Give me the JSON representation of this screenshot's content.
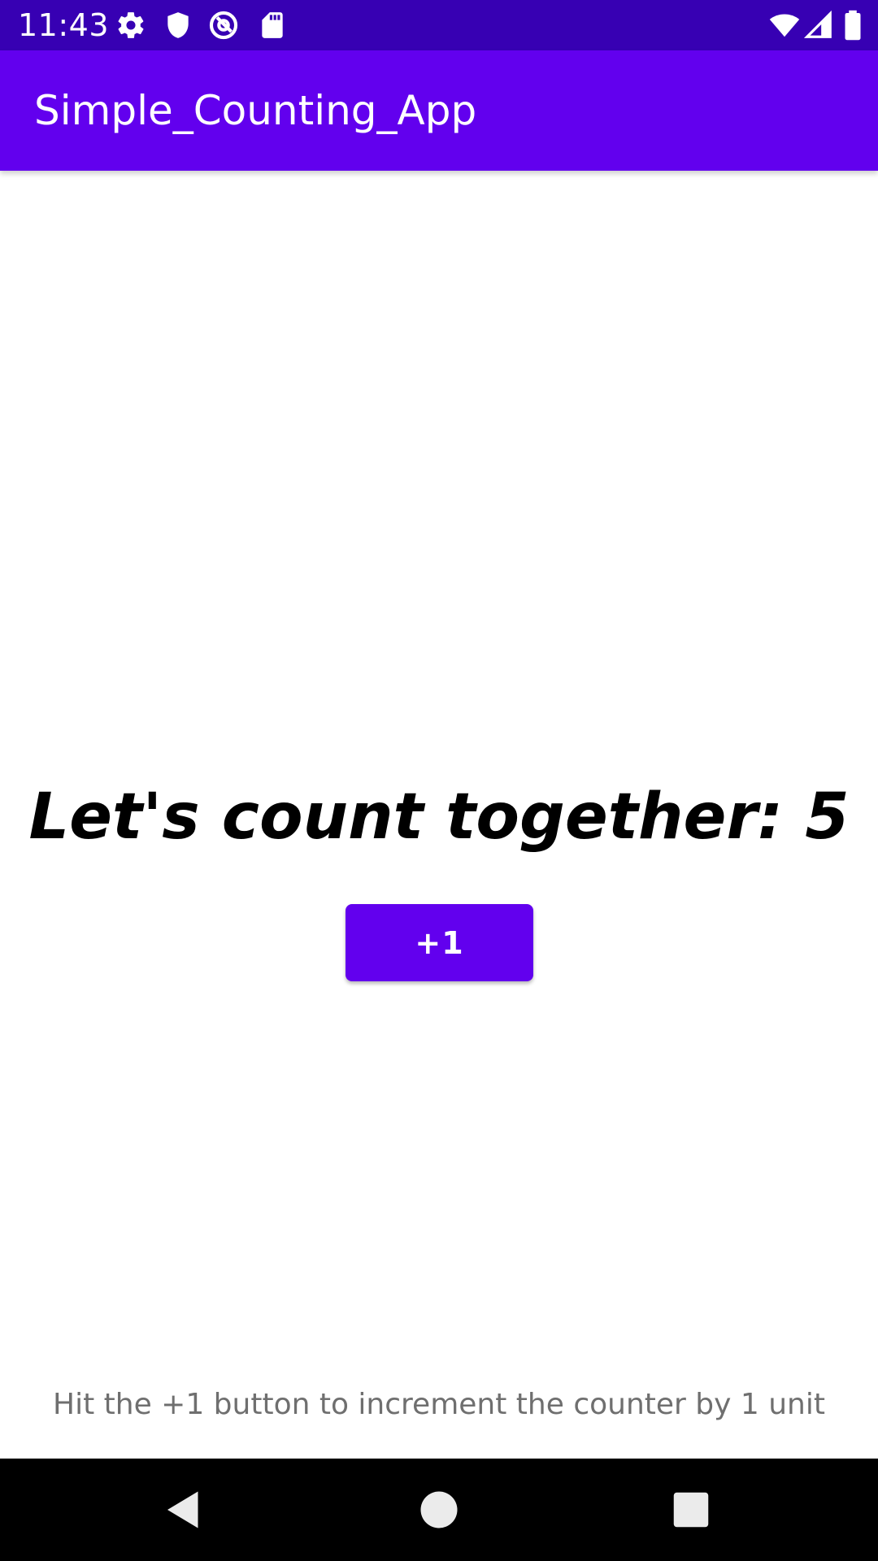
{
  "status_bar": {
    "time": "11:43",
    "icons": [
      "settings-icon",
      "shield-icon",
      "at-sign-icon",
      "sd-card-icon",
      "wifi-icon",
      "cell-signal-icon",
      "battery-icon"
    ]
  },
  "app_bar": {
    "title": "Simple_Counting_App"
  },
  "main": {
    "counter_text": "Let's count together: 5",
    "increment_button_label": "+1",
    "hint": "Hit the +1 button to increment the counter by 1 unit"
  },
  "nav_bar": {
    "icons": [
      "back-icon",
      "home-icon",
      "recents-icon"
    ]
  },
  "colors": {
    "status_bar": "#3700b3",
    "primary": "#6200ee",
    "background": "#ffffff",
    "nav_bar": "#000000",
    "hint_text": "#6f6f6f"
  }
}
